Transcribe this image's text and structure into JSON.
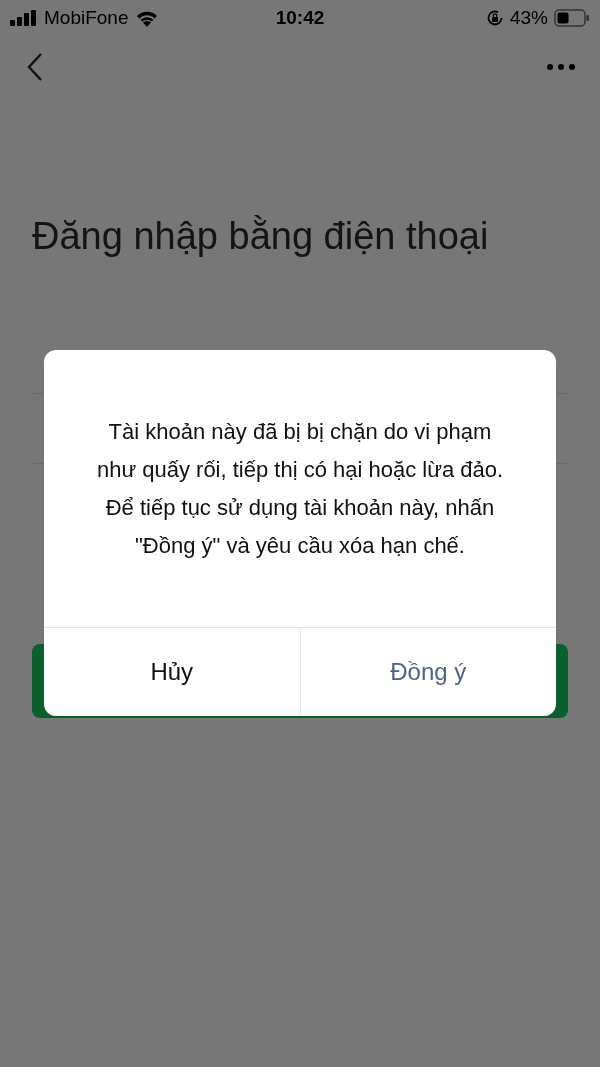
{
  "status_bar": {
    "carrier": "MobiFone",
    "time": "10:42",
    "battery": "43%"
  },
  "page": {
    "title": "Đăng nhập bằng điện thoại"
  },
  "dialog": {
    "message": "Tài khoản này đã bị bị chặn do vi phạm như quấy rối, tiếp thị có hại hoặc lừa đảo. Để tiếp tục sử dụng tài khoản này, nhấn \"Đồng ý\" và yêu cầu xóa hạn chế.",
    "buttons": [
      {
        "label": "Hủy",
        "kind": "cancel"
      },
      {
        "label": "Đồng ý",
        "kind": "confirm"
      }
    ]
  }
}
